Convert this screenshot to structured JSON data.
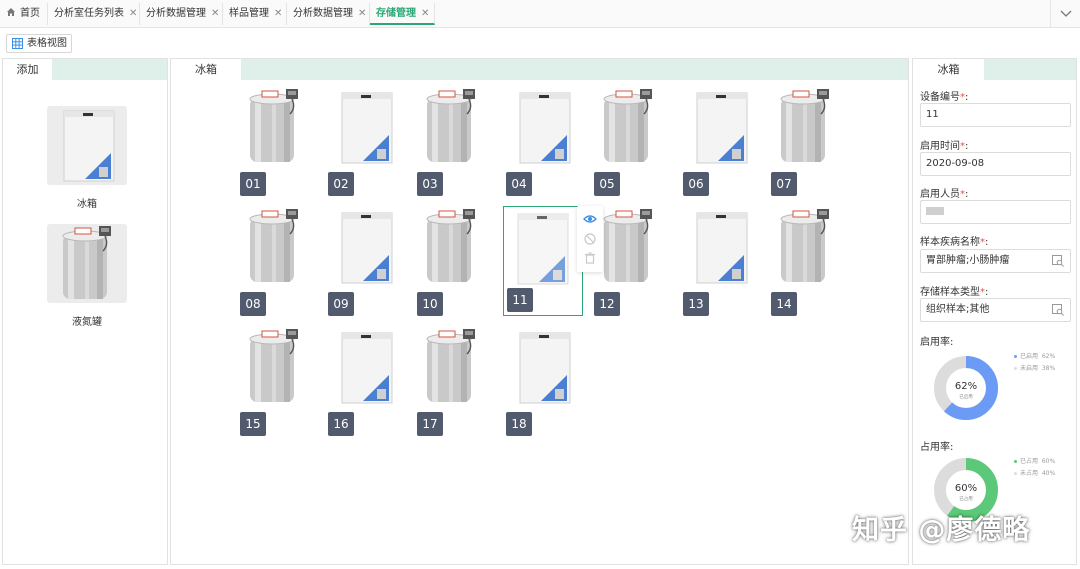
{
  "tabs": [
    {
      "label": "首页",
      "closable": false
    },
    {
      "label": "分析室任务列表",
      "closable": true
    },
    {
      "label": "分析数据管理",
      "closable": true
    },
    {
      "label": "样品管理",
      "closable": true
    },
    {
      "label": "分析数据管理",
      "closable": true
    },
    {
      "label": "存储管理",
      "closable": true,
      "active": true
    }
  ],
  "toolbar": {
    "table_view_label": "表格视图"
  },
  "left_panel": {
    "tab": "添加",
    "items": [
      {
        "label": "冰箱",
        "kind": "freezer"
      },
      {
        "label": "液氮罐",
        "kind": "tank"
      }
    ]
  },
  "middle_panel": {
    "tab": "冰箱",
    "devices": [
      {
        "no": "01",
        "kind": "tank"
      },
      {
        "no": "02",
        "kind": "freezer"
      },
      {
        "no": "03",
        "kind": "tank"
      },
      {
        "no": "04",
        "kind": "freezer"
      },
      {
        "no": "05",
        "kind": "tank"
      },
      {
        "no": "06",
        "kind": "freezer"
      },
      {
        "no": "07",
        "kind": "tank"
      },
      {
        "no": "08",
        "kind": "tank"
      },
      {
        "no": "09",
        "kind": "freezer"
      },
      {
        "no": "10",
        "kind": "tank"
      },
      {
        "no": "11",
        "kind": "freezer",
        "selected": true
      },
      {
        "no": "12",
        "kind": "tank"
      },
      {
        "no": "13",
        "kind": "freezer"
      },
      {
        "no": "14",
        "kind": "tank"
      },
      {
        "no": "15",
        "kind": "tank"
      },
      {
        "no": "16",
        "kind": "freezer"
      },
      {
        "no": "17",
        "kind": "tank"
      },
      {
        "no": "18",
        "kind": "freezer"
      }
    ],
    "actions": [
      "eye-icon",
      "disable-icon",
      "trash-icon"
    ]
  },
  "right_panel": {
    "tab": "冰箱",
    "fields": {
      "device_no": {
        "label": "设备编号",
        "value": "11"
      },
      "start_time": {
        "label": "启用时间",
        "value": "2020-09-08"
      },
      "operator": {
        "label": "启用人员",
        "value": ""
      },
      "disease": {
        "label": "样本疾病名称",
        "value": "胃部肿瘤;小肠肿瘤"
      },
      "sample_type": {
        "label": "存储样本类型",
        "value": "组织样本;其他"
      }
    },
    "enable_rate": {
      "label": "启用率:",
      "percent": 62,
      "percent_text": "62%",
      "center_caption": "已启用",
      "color": "#6b9bf4",
      "legend": [
        {
          "label": "已启用",
          "value": "62%",
          "color": "#6b9bf4"
        },
        {
          "label": "未启用",
          "value": "38%",
          "color": "#dcdcdc"
        }
      ]
    },
    "occupy_rate": {
      "label": "占用率:",
      "percent": 60,
      "percent_text": "60%",
      "center_caption": "已占用",
      "color": "#5cc97a",
      "legend": [
        {
          "label": "已占用",
          "value": "60%",
          "color": "#5cc97a"
        },
        {
          "label": "未占用",
          "value": "40%",
          "color": "#dcdcdc"
        }
      ]
    }
  },
  "watermark": "知乎 @廖德略"
}
